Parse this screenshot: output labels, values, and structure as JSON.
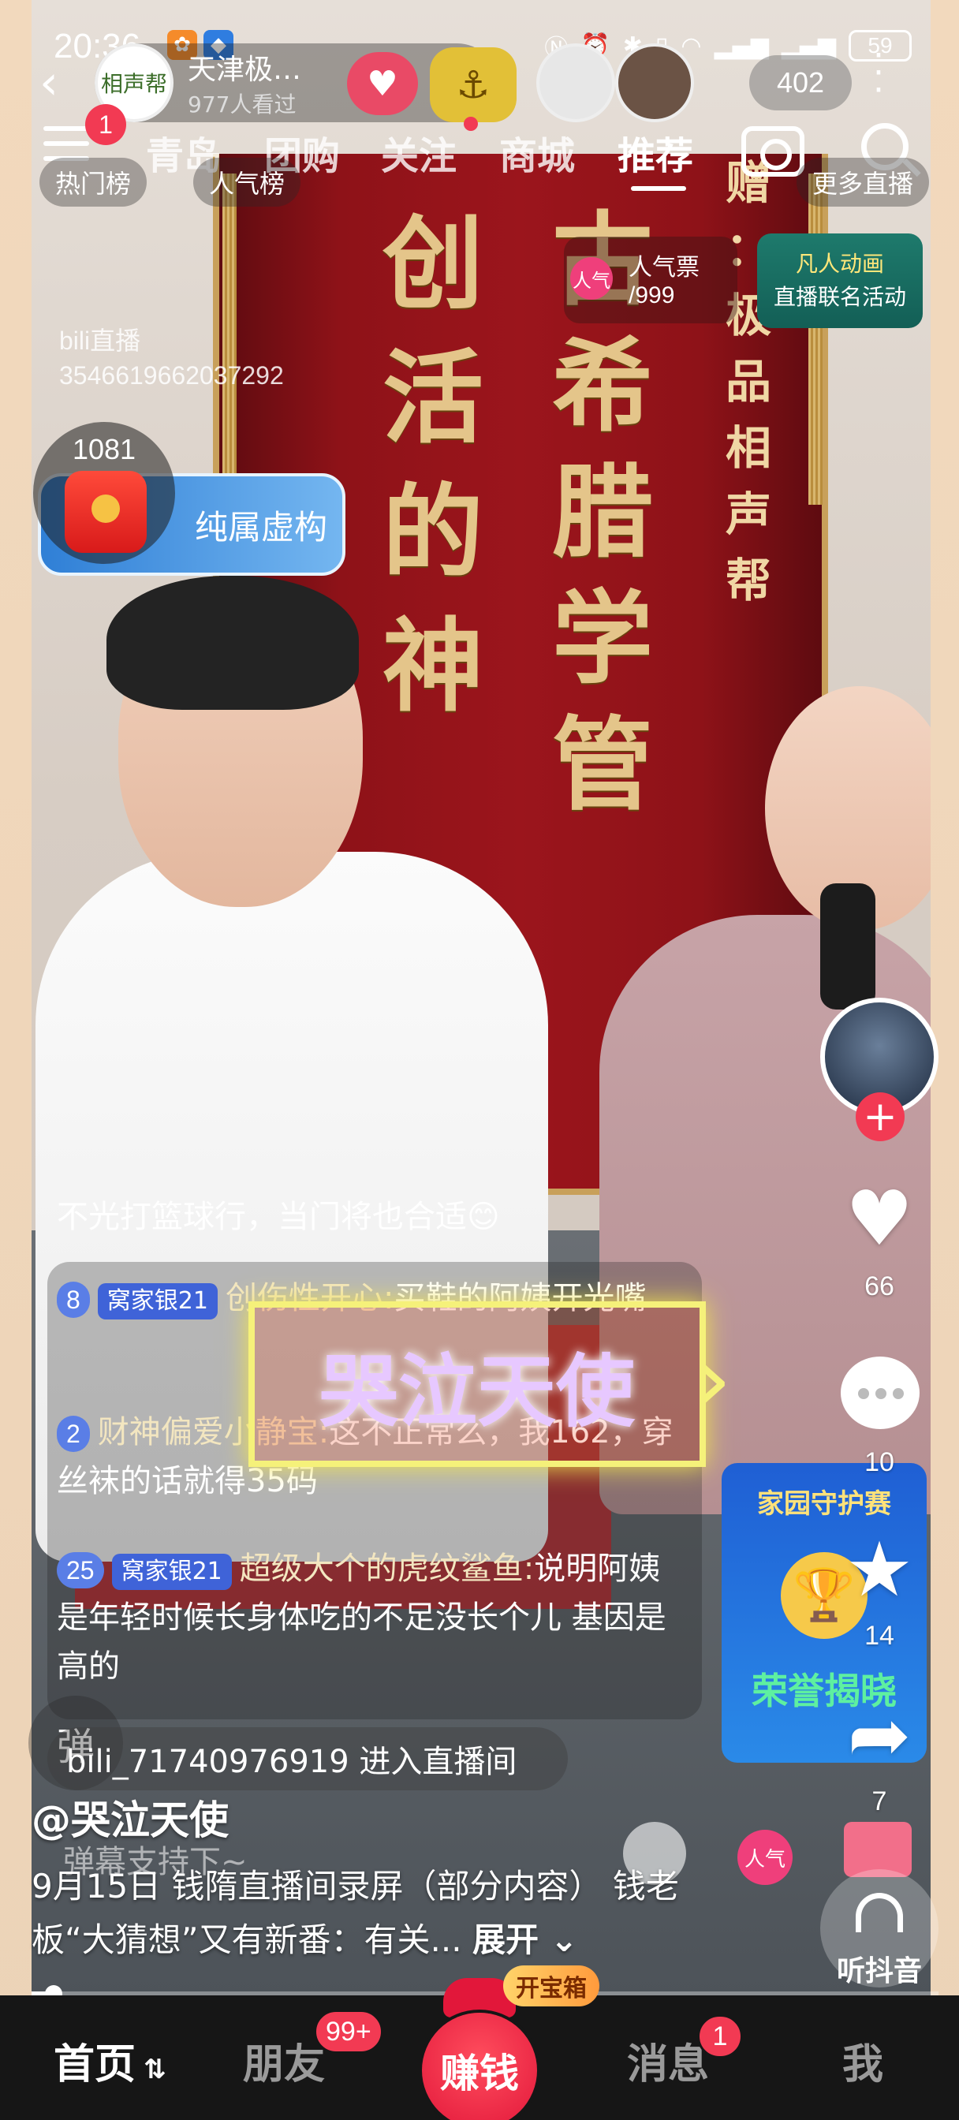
{
  "status_bar": {
    "time": "20:36",
    "battery": "59"
  },
  "live_card": {
    "avatar_text": "相声帮",
    "name": "天津极…",
    "viewers": "977人看过",
    "viewer_count": "402"
  },
  "top_nav": {
    "menu_badge": "1",
    "tabs": [
      "青岛",
      "团购",
      "关注",
      "商城",
      "推荐"
    ],
    "active_tab": "推荐"
  },
  "sub_chips": {
    "hot": "热门榜",
    "popularity_rank": "人气榜",
    "more_live": "更多直播"
  },
  "popularity": {
    "badge": "人气",
    "label": "人气票",
    "value": "/999"
  },
  "promo": {
    "line1": "凡人动画",
    "line2": "直播联名活动"
  },
  "watermark": {
    "line1": "bili直播",
    "line2": "3546619662037292"
  },
  "banner": {
    "col_left": [
      "创",
      "活",
      "的",
      "神"
    ],
    "col_mid": [
      "古",
      "希",
      "腊",
      "学",
      "管"
    ],
    "col_right": [
      "赠",
      "：",
      "极",
      "品",
      "相",
      "声",
      "帮"
    ]
  },
  "red_packet": {
    "count": "1081"
  },
  "virtual_tag": "纯属虚构",
  "chat": {
    "first": "不光打篮球行，当门将也合适😊",
    "messages": [
      {
        "level": "8",
        "tag": "窝家银21",
        "name": "创伤性开心:",
        "text": "买鞋的阿姨开光嘴"
      },
      {
        "level": "2",
        "tag": "",
        "name": "财神偏爱小静宝:",
        "text": "这不正常么，我162，穿丝袜的话就得35码"
      },
      {
        "level": "25",
        "tag": "窝家银21",
        "name": "超级大个的虎纹鲨鱼:",
        "text": "说明阿姨是年轻时候长身体吃的不足没长个儿 基因是高的"
      }
    ],
    "enter": "bili_71740976919 进入直播间",
    "dan_button": "弹"
  },
  "neon_name": "哭泣天使",
  "guard_card": {
    "title": "家园守护赛",
    "subtitle": "荣誉揭晓"
  },
  "side_actions": {
    "likes": "66",
    "comments": "10",
    "favorites": "14",
    "shares": "7",
    "listen_label": "听抖音"
  },
  "video_info": {
    "author": "@哭泣天使",
    "danmu_support": "弹幕支持下~",
    "caption": "9月15日 钱隋直播间录屏（部分内容） 钱老板“大猜想”又有新番：有关...",
    "expand": "展开"
  },
  "progress": {
    "fraction": 0.02
  },
  "bottom_nav": {
    "home": "首页",
    "friends": "朋友",
    "friends_badge": "99+",
    "earn": "赚钱",
    "treasure": "开宝箱",
    "messages": "消息",
    "messages_badge": "1",
    "me": "我"
  },
  "colors": {
    "accent_red": "#f23a53",
    "banner_red": "#9b151c",
    "gold": "#e4c58a"
  }
}
